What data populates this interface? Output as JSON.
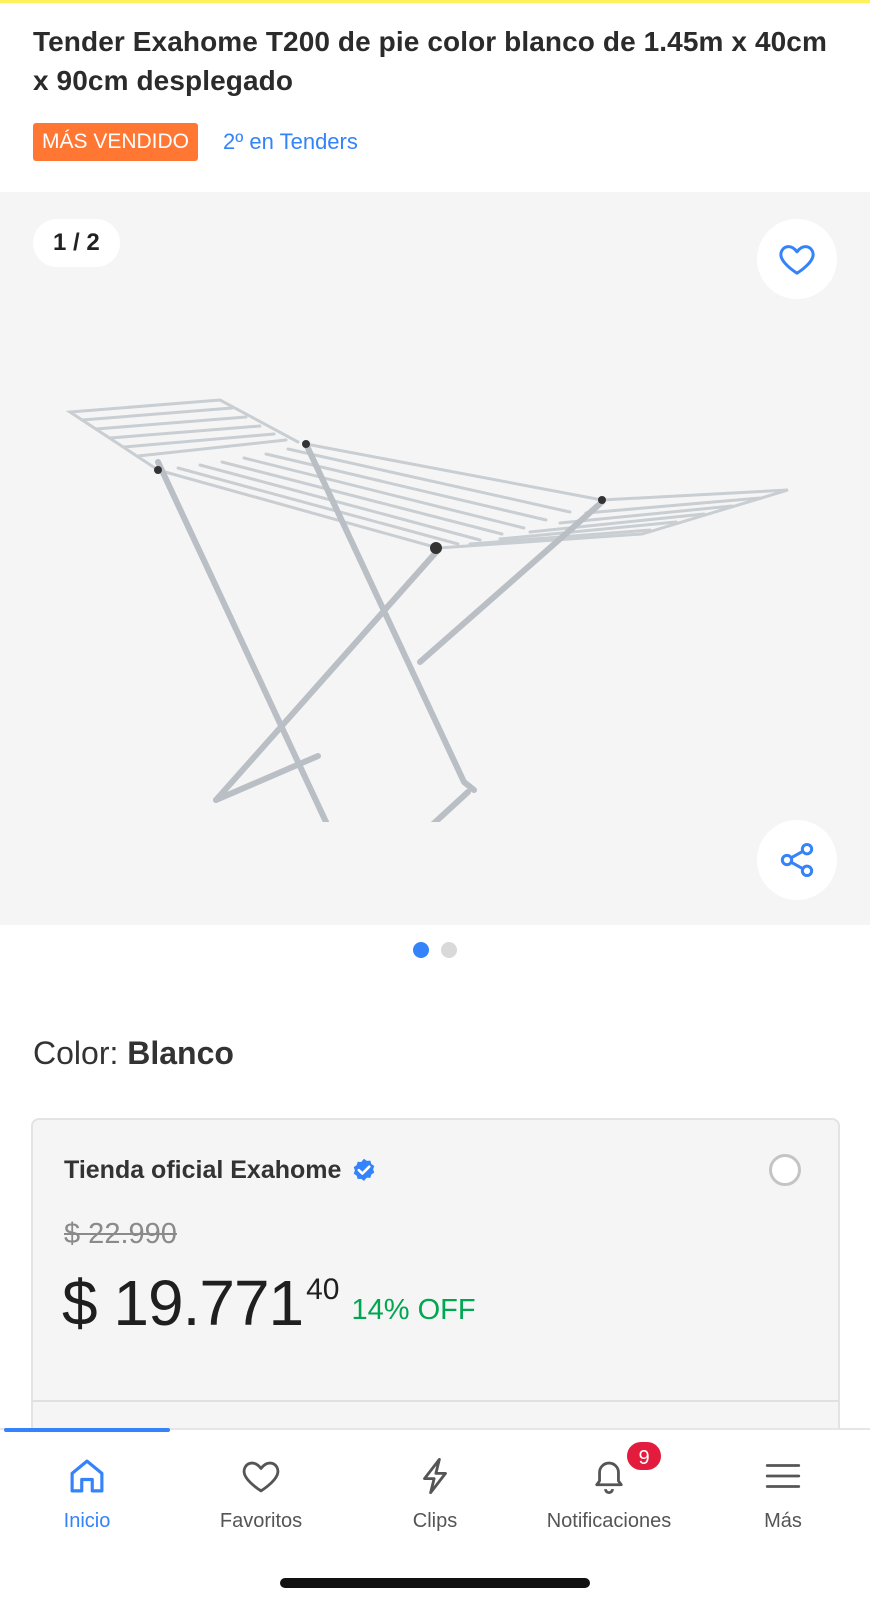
{
  "product": {
    "title": "Tender Exahome T200 de pie color blanco de 1.45m x 40cm x 90cm desplegado",
    "badge": "MÁS VENDIDO",
    "ranking": "2º en Tenders"
  },
  "gallery": {
    "counter": "1 / 2",
    "total_images": 2,
    "active_index": 1
  },
  "color": {
    "label": "Color:",
    "value": "Blanco"
  },
  "offer": {
    "store": "Tienda oficial Exahome",
    "original_price": "$ 22.990",
    "price_main": "$ 19.771",
    "price_cents": "40",
    "discount": "14% OFF",
    "selected": false
  },
  "bottom_nav": {
    "items": [
      {
        "label": "Inicio",
        "icon": "home-icon",
        "active": true
      },
      {
        "label": "Favoritos",
        "icon": "heart-icon",
        "active": false
      },
      {
        "label": "Clips",
        "icon": "lightning-icon",
        "active": false
      },
      {
        "label": "Notificaciones",
        "icon": "bell-icon",
        "active": false,
        "badge": "9"
      },
      {
        "label": "Más",
        "icon": "menu-icon",
        "active": false
      }
    ]
  },
  "colors": {
    "accent": "#3483fa",
    "badge_bg": "#ff7733",
    "discount": "#00a650",
    "notification_badge": "#e31c3d"
  }
}
